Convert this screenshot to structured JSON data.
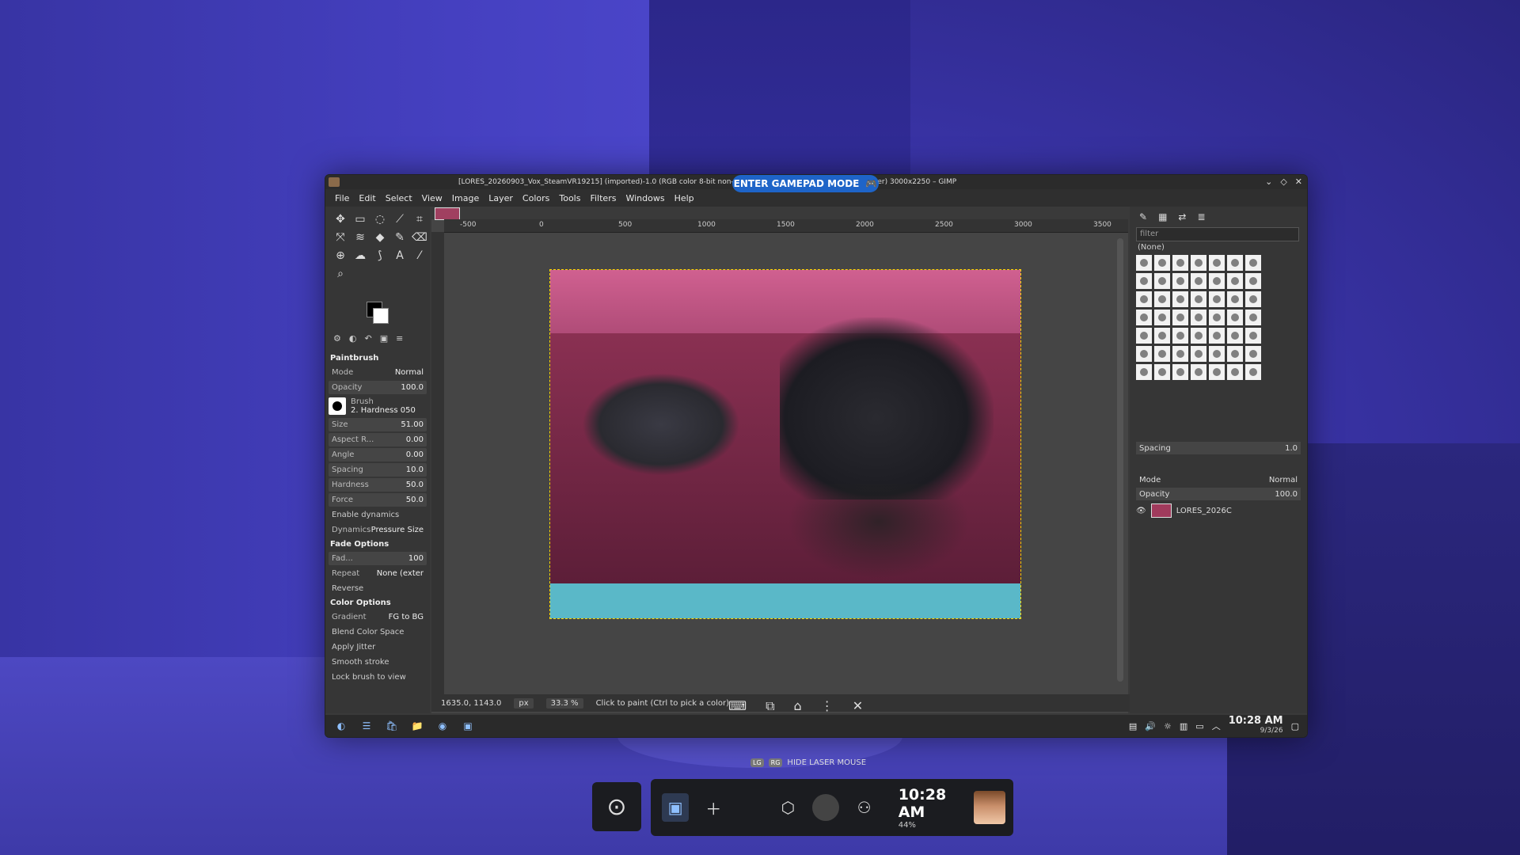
{
  "gamepad_mode_label": "ENTER GAMEPAD MODE",
  "window": {
    "title": "[LORES_20260903_Vox_SteamVR19215] (imported)-1.0 (RGB color 8-bit non-linear integer, sRGB IEC61966-2.1, 1 layer) 3000x2250 – GIMP"
  },
  "menu": [
    "File",
    "Edit",
    "Select",
    "View",
    "Image",
    "Layer",
    "Colors",
    "Tools",
    "Filters",
    "Windows",
    "Help"
  ],
  "tool_options": {
    "title": "Paintbrush",
    "mode_label": "Mode",
    "mode_value": "Normal",
    "opacity_label": "Opacity",
    "opacity_value": "100.0",
    "brush_label": "Brush",
    "brush_value": "2. Hardness 050",
    "size_label": "Size",
    "size_value": "51.00",
    "aspect_label": "Aspect R...",
    "aspect_value": "0.00",
    "angle_label": "Angle",
    "angle_value": "0.00",
    "spacing_label": "Spacing",
    "spacing_value": "10.0",
    "hardness_label": "Hardness",
    "hardness_value": "50.0",
    "force_label": "Force",
    "force_value": "50.0",
    "enable_dynamics": "Enable dynamics",
    "dynamics_label": "Dynamics",
    "dynamics_value": "Pressure Size",
    "fade_options": "Fade Options",
    "fade_label": "Fad...",
    "fade_value": "100",
    "repeat_label": "Repeat",
    "repeat_value": "None (exter",
    "reverse": "Reverse",
    "color_options": "Color Options",
    "gradient_label": "Gradient",
    "gradient_value": "FG to BG",
    "blend_color_space": "Blend Color Space",
    "apply_jitter": "Apply Jitter",
    "smooth_stroke": "Smooth stroke",
    "lock_brush": "Lock brush to view"
  },
  "ruler_marks": [
    "-500",
    "0",
    "500",
    "1000",
    "1500",
    "2000",
    "2500",
    "3000",
    "3500"
  ],
  "status": {
    "coords": "1635.0, 1143.0",
    "unit": "px",
    "zoom": "33.3 %",
    "message": "Click to paint (Ctrl to pick a color)"
  },
  "right_dock": {
    "filter_placeholder": "filter",
    "brush_none": "(None)",
    "spacing_label": "Spacing",
    "spacing_value": "1.0",
    "mode_label": "Mode",
    "mode_value": "Normal",
    "opacity_label": "Opacity",
    "opacity_value": "100.0",
    "layer_name": "LORES_2026C"
  },
  "tray": {
    "time": "10:28 AM",
    "date": "9/3/26"
  },
  "laser_hint": {
    "glyph_a": "LG",
    "glyph_b": "RG",
    "label": "HIDE LASER MOUSE"
  },
  "vr_dashboard": {
    "time": "10:28 AM",
    "battery": "44%"
  }
}
